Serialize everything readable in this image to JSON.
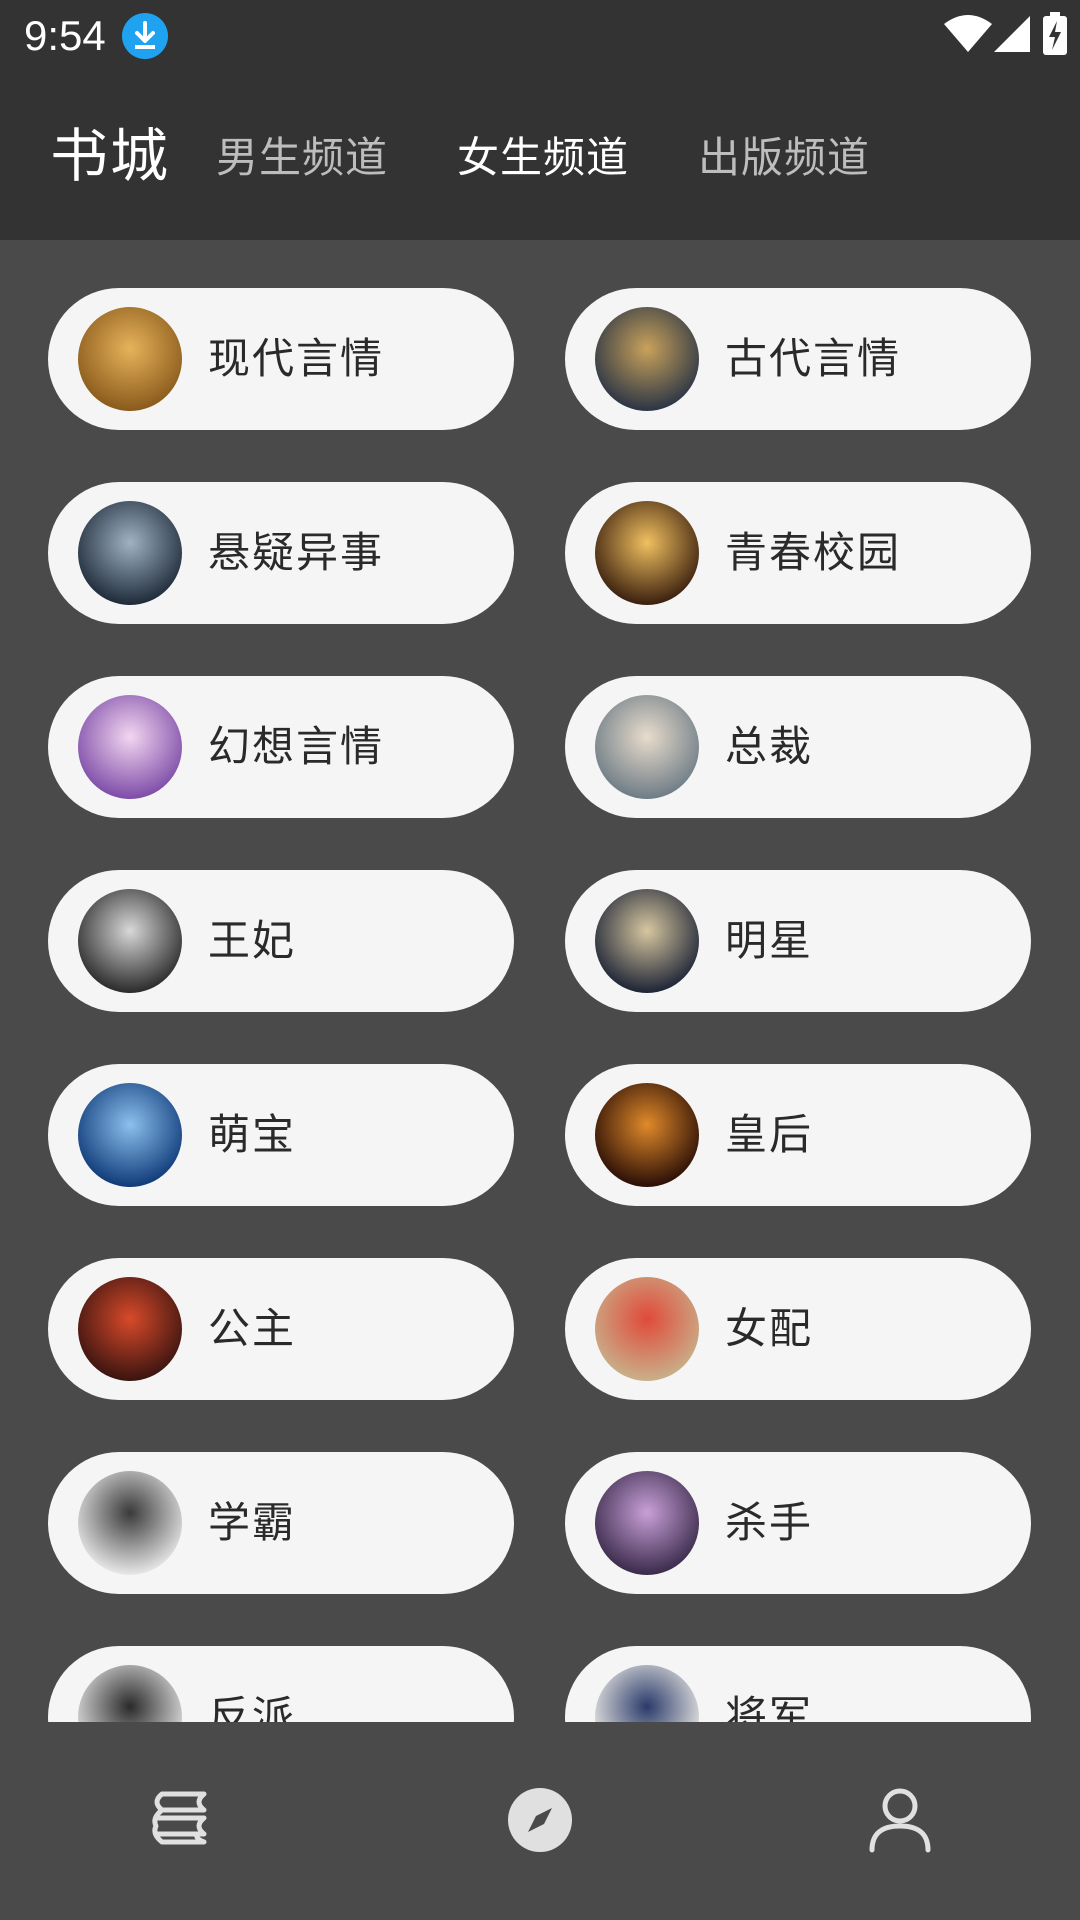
{
  "status_bar": {
    "time": "9:54",
    "icons": [
      "download-icon",
      "wifi-icon",
      "cellular-signal-icon",
      "battery-charging-icon"
    ]
  },
  "header": {
    "title": "书城",
    "tabs": [
      {
        "label": "男生频道",
        "active": false
      },
      {
        "label": "女生频道",
        "active": true
      },
      {
        "label": "出版频道",
        "active": false
      }
    ]
  },
  "categories": [
    {
      "label": "现代言情",
      "cover_colors": [
        "#8a5a1c",
        "#e6b35a"
      ]
    },
    {
      "label": "古代言情",
      "cover_colors": [
        "#2b3545",
        "#c9a25a"
      ]
    },
    {
      "label": "悬疑异事",
      "cover_colors": [
        "#1e2a38",
        "#9fb2c4"
      ]
    },
    {
      "label": "青春校园",
      "cover_colors": [
        "#3a1f0e",
        "#f0c060"
      ]
    },
    {
      "label": "幻想言情",
      "cover_colors": [
        "#7d4ca8",
        "#f3d6f0"
      ]
    },
    {
      "label": "总裁",
      "cover_colors": [
        "#6e7c86",
        "#e8dccc"
      ]
    },
    {
      "label": "王妃",
      "cover_colors": [
        "#2a2a2a",
        "#d8d8d8"
      ]
    },
    {
      "label": "明星",
      "cover_colors": [
        "#1d2436",
        "#d7c7a0"
      ]
    },
    {
      "label": "萌宝",
      "cover_colors": [
        "#0f3a78",
        "#8cc0ee"
      ]
    },
    {
      "label": "皇后",
      "cover_colors": [
        "#2a0e06",
        "#e08a2a"
      ]
    },
    {
      "label": "公主",
      "cover_colors": [
        "#3a1410",
        "#d84a2a"
      ]
    },
    {
      "label": "女配",
      "cover_colors": [
        "#c9b08a",
        "#e04a3a"
      ]
    },
    {
      "label": "学霸",
      "cover_colors": [
        "#e8e8e8",
        "#3a3a3a"
      ]
    },
    {
      "label": "杀手",
      "cover_colors": [
        "#3a2a4a",
        "#c8a0d8"
      ]
    },
    {
      "label": "反派",
      "cover_colors": [
        "#e6e6e6",
        "#2a2a2a"
      ]
    },
    {
      "label": "将军",
      "cover_colors": [
        "#f0eee8",
        "#2a3a6a"
      ]
    }
  ],
  "bottom_nav": [
    {
      "name": "bookshelf",
      "icon": "bookshelf-icon",
      "active": false
    },
    {
      "name": "discover",
      "icon": "compass-icon",
      "active": true
    },
    {
      "name": "me",
      "icon": "user-icon",
      "active": false
    }
  ],
  "colors": {
    "background": "#4a4a4a",
    "bar": "#333333",
    "pill": "#f5f5f5",
    "label_text": "#2a2a2a",
    "tab_inactive": "#bdbdbd",
    "tab_active": "#ffffff",
    "nav_icon": "#e0e0e0"
  }
}
